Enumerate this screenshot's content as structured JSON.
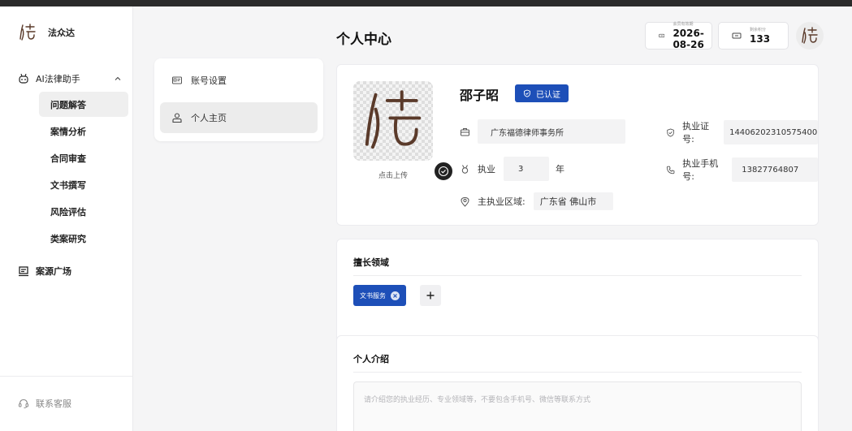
{
  "brand": {
    "name": "法众达"
  },
  "sidebar": {
    "group_label": "AI法律助手",
    "items": [
      {
        "label": "问题解答",
        "active": true
      },
      {
        "label": "案情分析"
      },
      {
        "label": "合同审查"
      },
      {
        "label": "文书撰写"
      },
      {
        "label": "风险评估"
      },
      {
        "label": "类案研究"
      }
    ],
    "other_label": "案源广场",
    "support_label": "联系客服"
  },
  "settings_menu": {
    "items": [
      {
        "label": "账号设置"
      },
      {
        "label": "个人主页",
        "active": true
      }
    ]
  },
  "header": {
    "title": "个人中心",
    "membership": {
      "label": "会员有效期",
      "value": "2026-08-26"
    },
    "points": {
      "label": "剩余积分",
      "value": "133"
    }
  },
  "profile": {
    "upload_label": "点击上传",
    "name": "邵子昭",
    "verified_label": "已认证",
    "firm": "广东福德律师事务所",
    "practice_prefix": "执业",
    "practice_years": "3",
    "practice_suffix": "年",
    "region_label": "主执业区域:",
    "region_value": "广东省 佛山市",
    "license_label": "执业证号:",
    "license_value": "14406202310575400",
    "phone_label": "执业手机号:",
    "phone_value": "13827764807"
  },
  "skills": {
    "title": "擅长领域",
    "tags": [
      "文书服务"
    ]
  },
  "intro": {
    "title": "个人介绍",
    "placeholder": "请介绍您的执业经历、专业领域等，不要包含手机号、微信等联系方式"
  },
  "colors": {
    "accent": "#1d4fb8",
    "active_bg": "#ececec"
  }
}
